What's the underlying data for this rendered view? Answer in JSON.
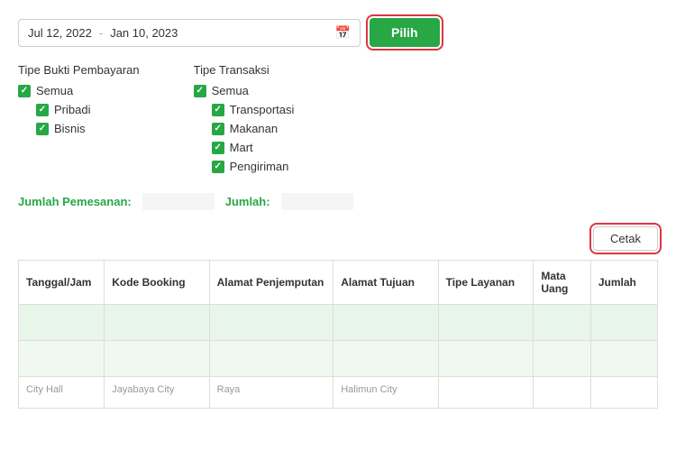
{
  "dateRange": {
    "startDate": "Jul 12, 2022",
    "endDate": "Jan 10, 2023",
    "separator": "-",
    "calendarIcon": "📅"
  },
  "pilihButton": {
    "label": "Pilih"
  },
  "cetakButton": {
    "label": "Cetak"
  },
  "paymentFilter": {
    "title": "Tipe Bukti Pembayaran",
    "items": [
      {
        "label": "Semua",
        "checked": true,
        "indented": false
      },
      {
        "label": "Pribadi",
        "checked": true,
        "indented": true
      },
      {
        "label": "Bisnis",
        "checked": true,
        "indented": true
      }
    ]
  },
  "transactionFilter": {
    "title": "Tipe Transaksi",
    "items": [
      {
        "label": "Semua",
        "checked": true,
        "indented": false
      },
      {
        "label": "Transportasi",
        "checked": true,
        "indented": true
      },
      {
        "label": "Makanan",
        "checked": true,
        "indented": true
      },
      {
        "label": "Mart",
        "checked": true,
        "indented": true
      },
      {
        "label": "Pengiriman",
        "checked": true,
        "indented": true
      }
    ]
  },
  "summary": {
    "orderLabel": "Jumlah Pemesanan:",
    "amountLabel": "Jumlah:",
    "orderValue": "",
    "amountValue": ""
  },
  "table": {
    "columns": [
      "Tanggal/Jam",
      "Kode Booking",
      "Alamat Penjemputan",
      "Alamat Tujuan",
      "Tipe Layanan",
      "Mata Uang",
      "Jumlah"
    ],
    "row3": {
      "col1": "City Hall",
      "col2": "Jayabaya City",
      "col3": "Raya",
      "col4": "Halimun City"
    }
  }
}
